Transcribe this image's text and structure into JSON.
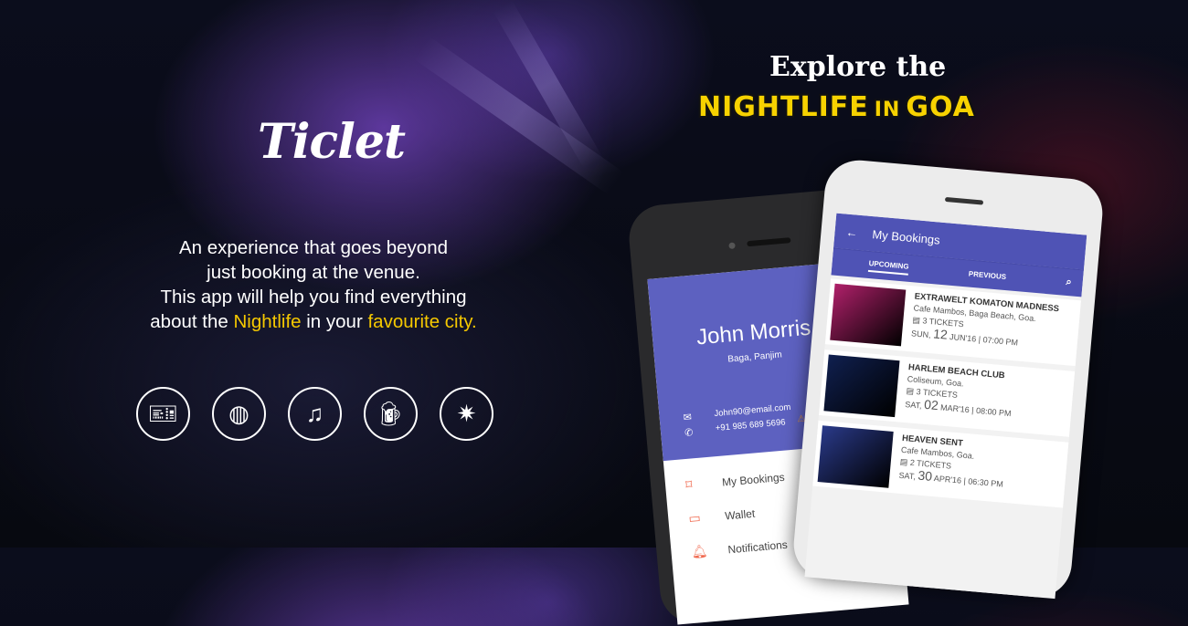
{
  "logo": "Ticlet",
  "tagline": {
    "l1": "An experience that goes beyond",
    "l2": "just booking at the venue.",
    "l3": "This app will help you find everything",
    "l4a": "about the ",
    "l4b": "Nightlife",
    "l4c": " in your ",
    "l4d": "favourite city."
  },
  "headline": {
    "top": "Explore the",
    "word1": "NIGHTLIFE",
    "word2": "IN",
    "word3": "GOA"
  },
  "feature_icons": [
    "ticket-icon",
    "disco-ball-icon",
    "music-note-icon",
    "beer-mug-icon",
    "fireworks-icon"
  ],
  "profile": {
    "name": "John Morris",
    "location": "Baga, Panjim",
    "email": "John90@email.com",
    "phone": "+91 985 689 5696",
    "menu": [
      {
        "label": "My Bookings",
        "icon": "ticket-icon"
      },
      {
        "label": "Wallet",
        "icon": "wallet-icon"
      },
      {
        "label": "Notifications",
        "icon": "bell-icon"
      }
    ]
  },
  "bookings": {
    "title": "My Bookings",
    "tabs": [
      "UPCOMING",
      "PREVIOUS"
    ],
    "items": [
      {
        "title": "EXTRAWELT KOMATON MADNESS",
        "venue": "Cafe Mambos, Baga Beach, Goa.",
        "tickets": "3  TICKETS",
        "day": "SUN,",
        "date": "12",
        "month": "JUN'16",
        "time": "07:00 PM",
        "color": "#b0206a"
      },
      {
        "title": "HARLEM BEACH CLUB",
        "venue": "Coliseum, Goa.",
        "tickets": "3  TICKETS",
        "day": "SAT,",
        "date": "02",
        "month": "MAR'16",
        "time": "08:00 PM",
        "color": "#102050"
      },
      {
        "title": "HEAVEN SENT",
        "venue": "Cafe Mambos, Goa.",
        "tickets": "2  TICKETS",
        "day": "SAT,",
        "date": "30",
        "month": "APR'16",
        "time": "06:30 PM",
        "color": "#2a3a8a"
      }
    ]
  },
  "colors": {
    "accent": "#f5c800",
    "primary": "#4f53b5"
  }
}
